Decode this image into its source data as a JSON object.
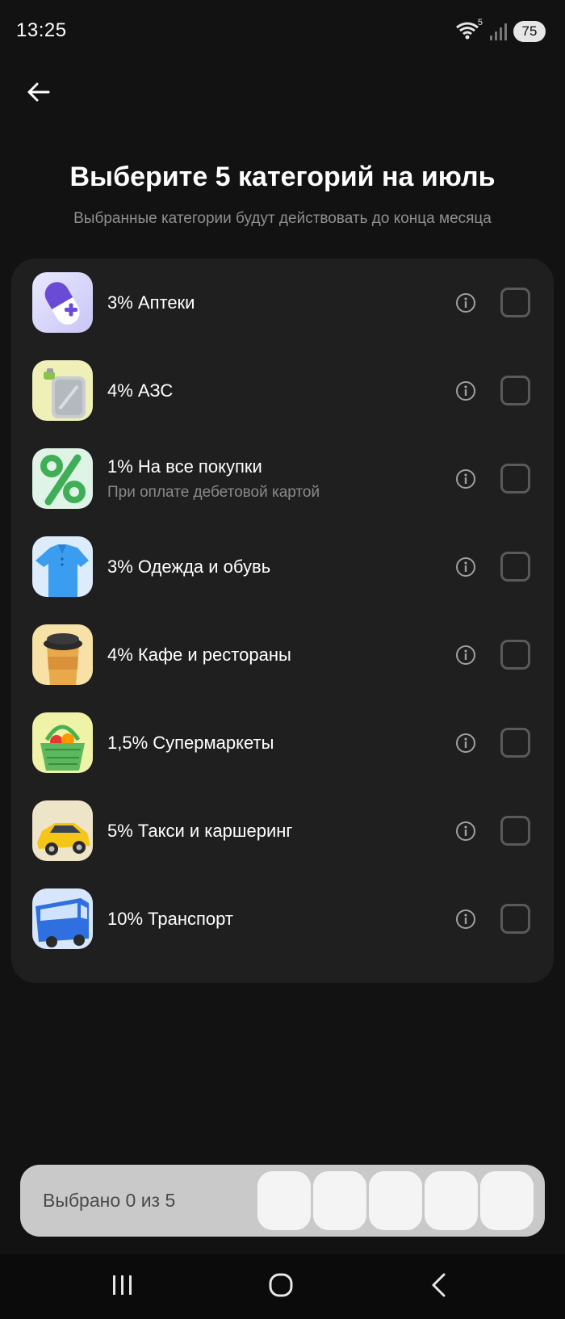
{
  "status_bar": {
    "time": "13:25",
    "battery": "75",
    "wifi_badge": "5"
  },
  "header": {
    "back_icon": "arrow-left-icon",
    "title": "Выберите 5 категорий на июль",
    "subtitle": "Выбранные категории будут действовать до конца месяца"
  },
  "categories": [
    {
      "label": "3% Аптеки",
      "sublabel": "",
      "icon": "pill-icon",
      "checked": false
    },
    {
      "label": "4% АЗС",
      "sublabel": "",
      "icon": "fuel-canister-icon",
      "checked": false
    },
    {
      "label": "1% На все покупки",
      "sublabel": "При оплате дебетовой картой",
      "icon": "percent-icon",
      "checked": false
    },
    {
      "label": "3% Одежда и обувь",
      "sublabel": "",
      "icon": "polo-shirt-icon",
      "checked": false
    },
    {
      "label": "4% Кафе и рестораны",
      "sublabel": "",
      "icon": "coffee-cup-icon",
      "checked": false
    },
    {
      "label": "1,5% Супермаркеты",
      "sublabel": "",
      "icon": "grocery-basket-icon",
      "checked": false
    },
    {
      "label": "5% Такси и каршеринг",
      "sublabel": "",
      "icon": "taxi-car-icon",
      "checked": false
    },
    {
      "label": "10% Транспорт",
      "sublabel": "",
      "icon": "bus-icon",
      "checked": false
    }
  ],
  "selection": {
    "label": "Выбрано 0 из 5",
    "selected": 0,
    "max": 5
  },
  "colors": {
    "background": "#121212",
    "card": "#1f1f1f",
    "bottom_bar": "#c9c9c9"
  }
}
